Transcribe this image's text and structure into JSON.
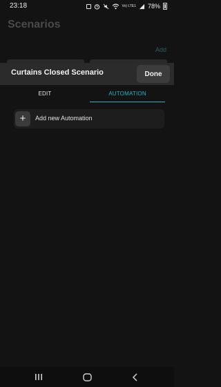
{
  "status_bar": {
    "time": "23:18",
    "network_label": "Vo) LTE1",
    "battery": "78%"
  },
  "background": {
    "title": "Scenarios",
    "add_label": "Add"
  },
  "sheet": {
    "title": "Curtains Closed Scenario",
    "done_label": "Done"
  },
  "tabs": [
    {
      "label": "EDIT",
      "active": false
    },
    {
      "label": "AUTOMATION",
      "active": true
    }
  ],
  "automation": {
    "add_label": "Add new Automation"
  },
  "colors": {
    "accent": "#2bb3c3",
    "background": "#131313",
    "header": "#2b2b2b"
  },
  "icons": [
    "notification-square-icon",
    "alarm-icon",
    "mute-icon",
    "wifi-icon",
    "signal-icon",
    "battery-icon",
    "plus-icon",
    "recents-icon",
    "home-icon",
    "back-icon"
  ]
}
